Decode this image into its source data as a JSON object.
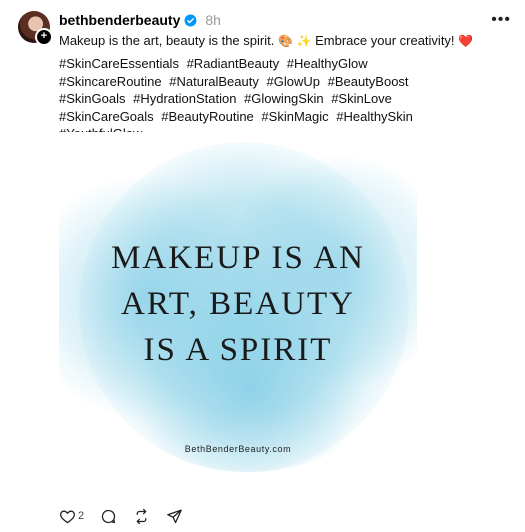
{
  "post": {
    "username": "bethbenderbeauty",
    "time": "8h",
    "caption_text": "Makeup is the art, beauty is the spirit.",
    "caption_emoji1": "🎨",
    "caption_emoji2": "✨",
    "caption_text2": "Embrace your creativity!",
    "caption_emoji3": "❤️",
    "hashtags": [
      "#SkinCareEssentials",
      "#RadiantBeauty",
      "#HealthyGlow",
      "#SkincareRoutine",
      "#NaturalBeauty",
      "#GlowUp",
      "#BeautyBoost",
      "#SkinGoals",
      "#HydrationStation",
      "#GlowingSkin",
      "#SkinLove",
      "#SkinCareGoals",
      "#BeautyRoutine",
      "#SkinMagic",
      "#HealthySkin",
      "#YouthfulGlow"
    ],
    "image": {
      "quote_line1": "MAKEUP IS AN",
      "quote_line2": "ART, BEAUTY",
      "quote_line3": "IS A SPIRIT",
      "site": "BethBenderBeauty.com"
    },
    "actions": {
      "like_count": "2"
    },
    "colors": {
      "accent_blue": "#0095f6",
      "watercolor": "#8fd3e8"
    }
  }
}
